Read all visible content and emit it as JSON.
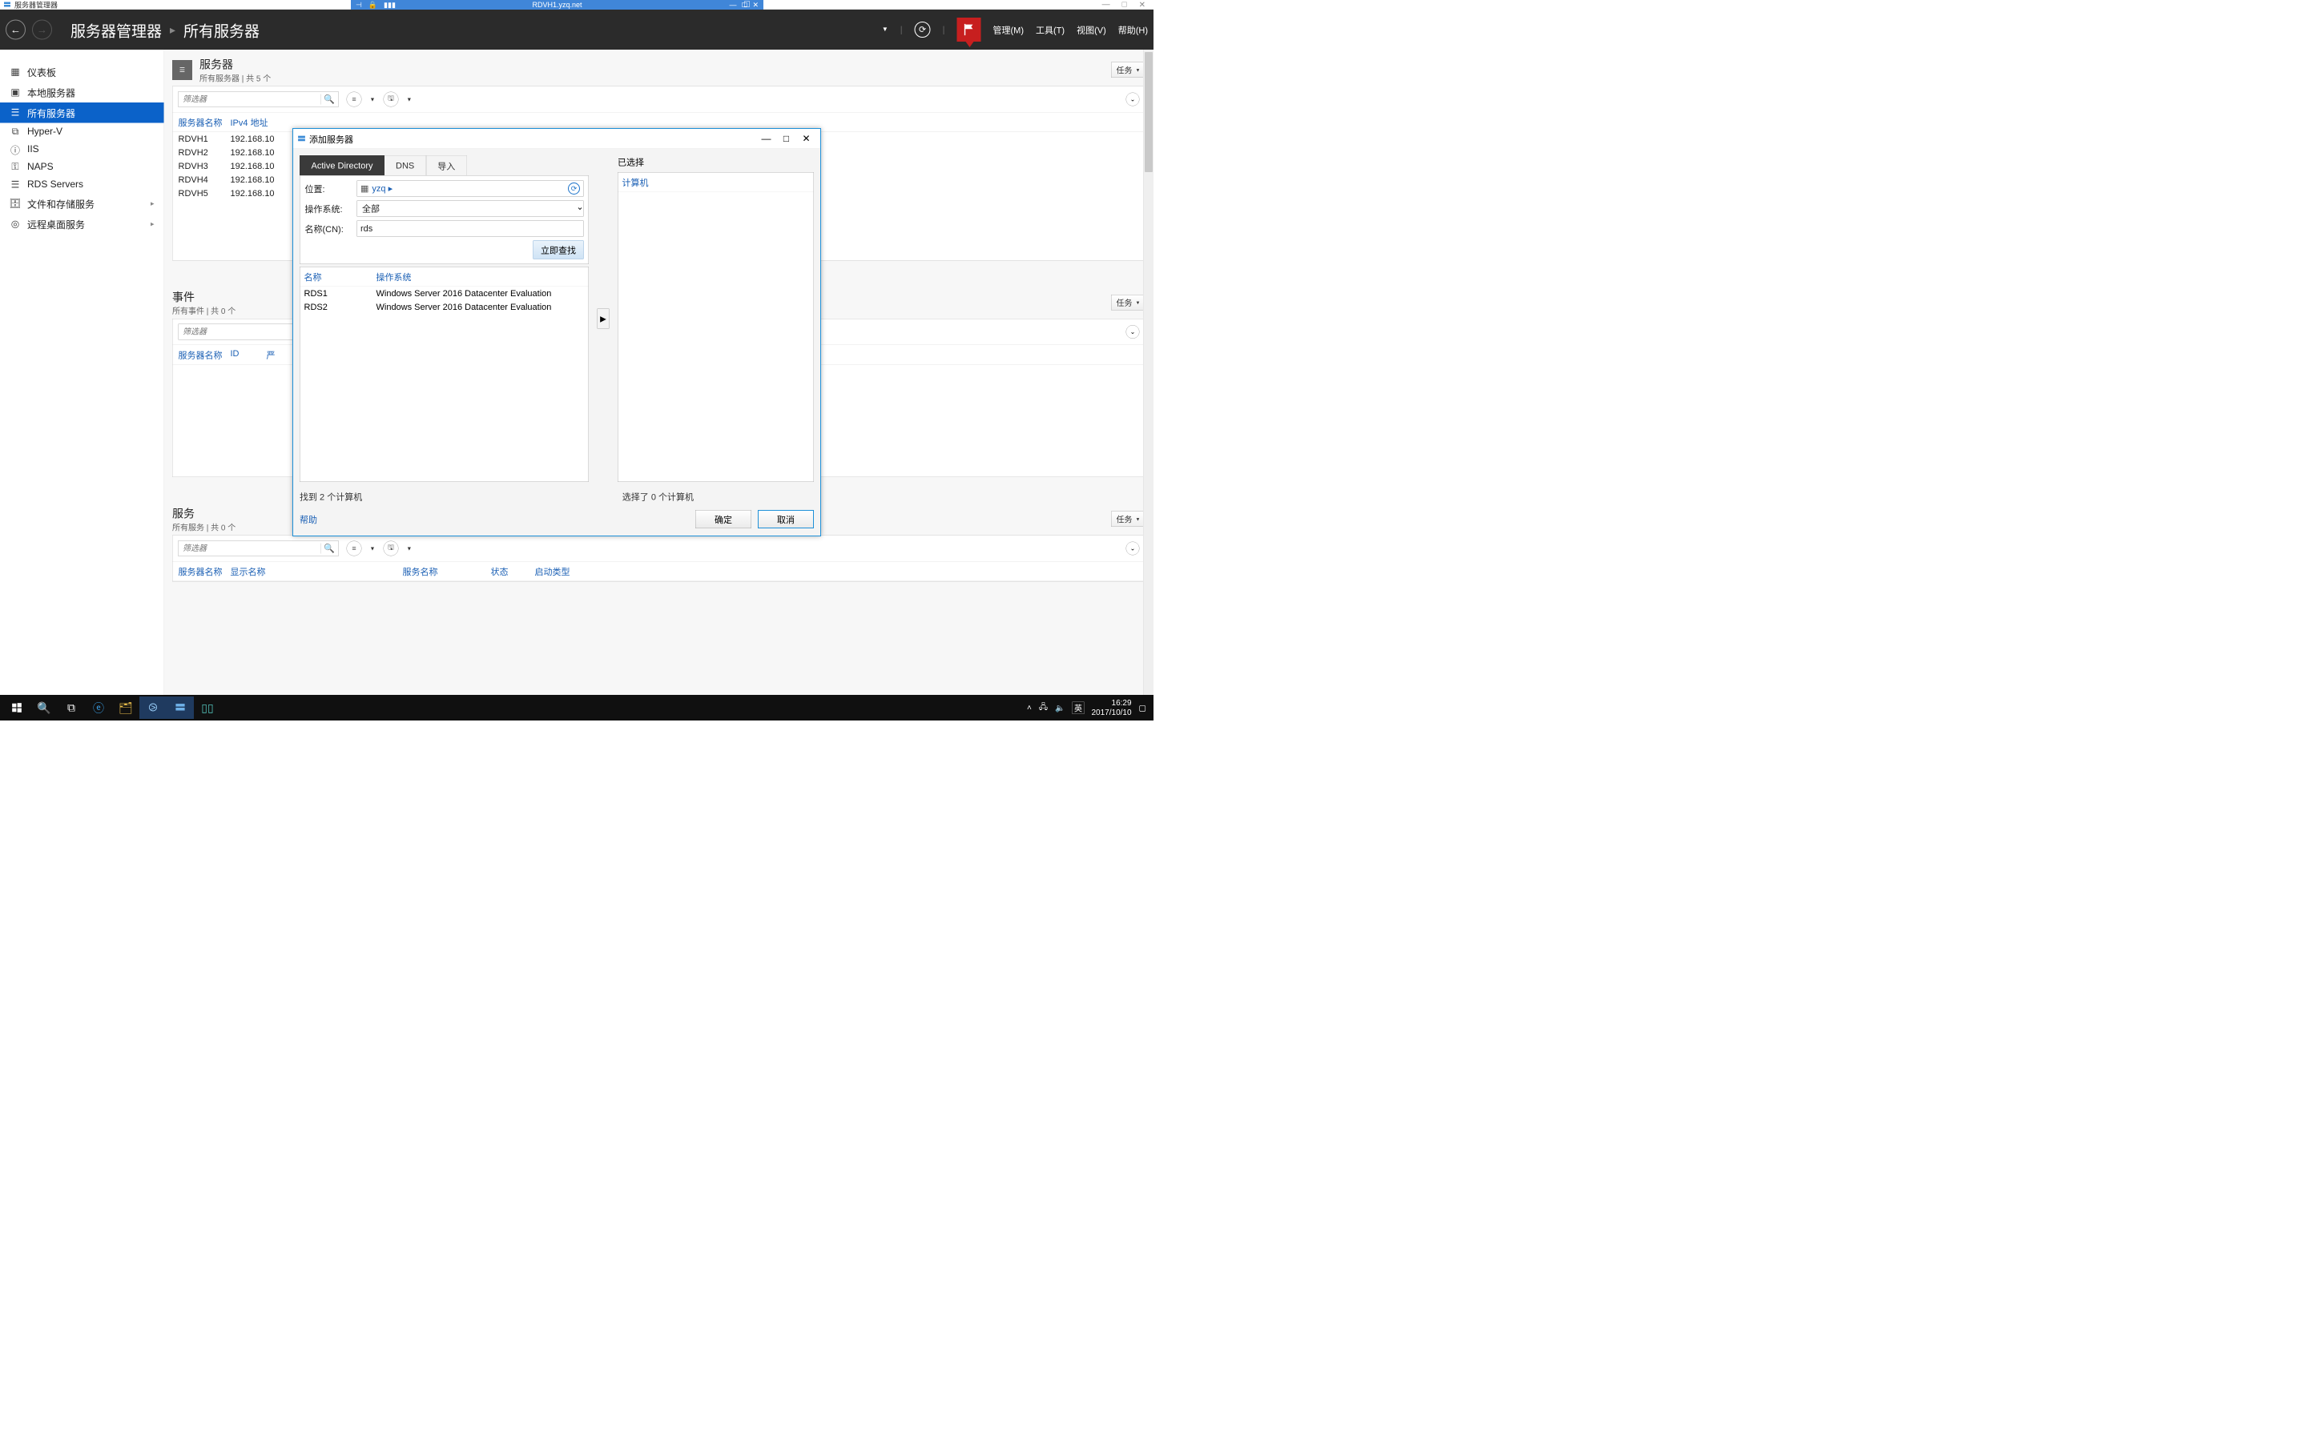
{
  "outer_window": {
    "title": "服务器管理器"
  },
  "outer_window_controls": {
    "min": "—",
    "max": "□",
    "close": "✕"
  },
  "vm_bar": {
    "title": "RDVH1.yzq.net",
    "icons_left": [
      "⇄",
      "🔒",
      "📶"
    ],
    "icons_right_min": "—",
    "icons_right_close": "✕"
  },
  "sm_header": {
    "app": "服务器管理器",
    "page": "所有服务器",
    "menus": {
      "manage": "管理(M)",
      "tools": "工具(T)",
      "view": "视图(V)",
      "help": "帮助(H)"
    }
  },
  "sidebar": {
    "items": [
      {
        "label": "仪表板",
        "icon": "dashboard"
      },
      {
        "label": "本地服务器",
        "icon": "server"
      },
      {
        "label": "所有服务器",
        "icon": "servers"
      },
      {
        "label": "Hyper-V",
        "icon": "hyperv"
      },
      {
        "label": "IIS",
        "icon": "iis"
      },
      {
        "label": "NAPS",
        "icon": "key"
      },
      {
        "label": "RDS Servers",
        "icon": "rds"
      },
      {
        "label": "文件和存储服务",
        "icon": "storage",
        "chev": "▸"
      },
      {
        "label": "远程桌面服务",
        "icon": "remote",
        "chev": "▸"
      }
    ]
  },
  "sections": {
    "servers": {
      "title": "服务器",
      "subtitle": "所有服务器 | 共 5 个",
      "tasks": "任务",
      "filter_ph": "筛选器",
      "cols": {
        "name": "服务器名称",
        "ip": "IPv4 地址"
      },
      "rows": [
        {
          "name": "RDVH1",
          "ip": "192.168.10"
        },
        {
          "name": "RDVH2",
          "ip": "192.168.10"
        },
        {
          "name": "RDVH3",
          "ip": "192.168.10"
        },
        {
          "name": "RDVH4",
          "ip": "192.168.10"
        },
        {
          "name": "RDVH5",
          "ip": "192.168.10"
        }
      ]
    },
    "events": {
      "title": "事件",
      "subtitle": "所有事件 | 共 0 个",
      "tasks": "任务",
      "filter_ph": "筛选器",
      "cols": {
        "name": "服务器名称",
        "id": "ID",
        "sev": "严"
      }
    },
    "services": {
      "title": "服务",
      "subtitle": "所有服务 | 共 0 个",
      "tasks": "任务",
      "filter_ph": "筛选器",
      "cols": {
        "name": "服务器名称",
        "disp": "显示名称",
        "svc": "服务名称",
        "stat": "状态",
        "start": "启动类型"
      }
    }
  },
  "dialog": {
    "title": "添加服务器",
    "tabs": {
      "ad": "Active Directory",
      "dns": "DNS",
      "import": "导入"
    },
    "labels": {
      "location": "位置:",
      "os": "操作系统:",
      "cn": "名称(CN):"
    },
    "location_value": "yzq  ▸",
    "os_value": "全部",
    "cn_value": "rds",
    "find_btn": "立即查找",
    "result_cols": {
      "name": "名称",
      "os": "操作系统"
    },
    "results": [
      {
        "name": "RDS1",
        "os": "Windows Server 2016 Datacenter Evaluation"
      },
      {
        "name": "RDS2",
        "os": "Windows Server 2016 Datacenter Evaluation"
      }
    ],
    "found_status": "找到 2 个计算机",
    "selected_title": "已选择",
    "selected_head": "计算机",
    "selected_status": "选择了 0 个计算机",
    "move_arrow": "▶",
    "help": "帮助",
    "ok": "确定",
    "cancel": "取消"
  },
  "taskbar": {
    "ime": "英",
    "time": "16:29",
    "date": "2017/10/10"
  }
}
